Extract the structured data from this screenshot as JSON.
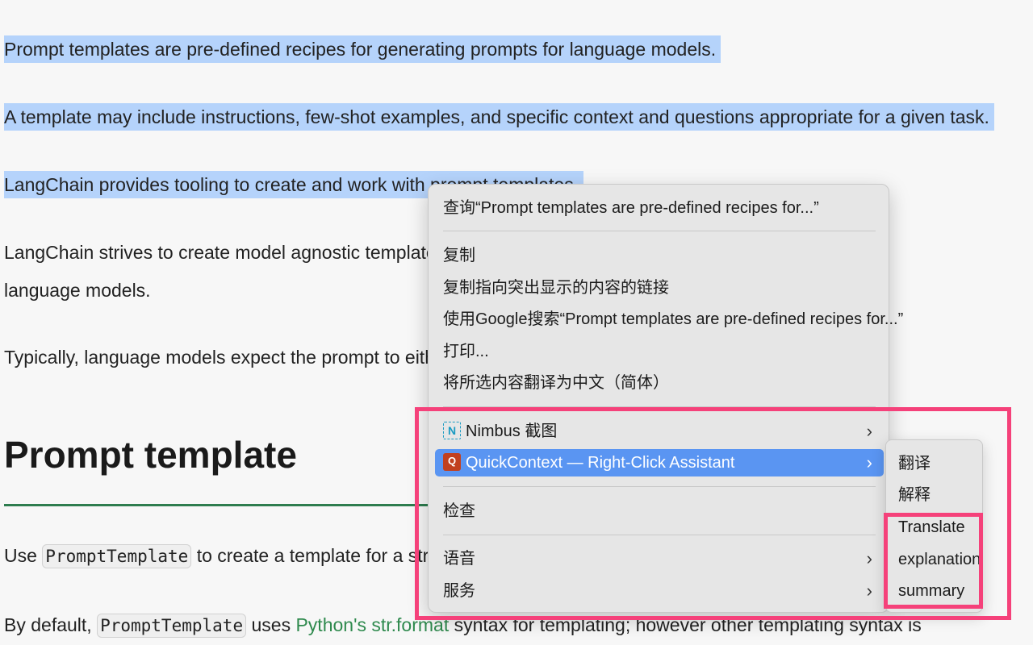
{
  "document": {
    "p1": "Prompt templates are pre-defined recipes for generating prompts for language models.",
    "p2": "A template may include instructions, few-shot examples, and specific context and questions appropriate for a given task.",
    "p3": "LangChain provides tooling to create and work with prompt templates.",
    "p4_line1": "LangChain strives to create model agnostic templates to m",
    "p4_line2": "language models.",
    "p5": "Typically, language models expect the prompt to either be",
    "heading": "Prompt template",
    "p6_before": "Use ",
    "p6_code": "PromptTemplate",
    "p6_after": " to create a template for a string pro",
    "p7_before": "By default, ",
    "p7_code": "PromptTemplate",
    "p7_mid": " uses ",
    "p7_link": "Python's str.format",
    "p7_after": " syntax for templating; however other templating syntax is"
  },
  "context_menu": {
    "lookup": "查询“Prompt templates are pre-defined recipes for...”",
    "copy": "复制",
    "copy_link_highlight": "复制指向突出显示的内容的链接",
    "search_google": "使用Google搜索“Prompt templates are pre-defined recipes for...”",
    "print": "打印...",
    "translate_selection": "将所选内容翻译为中文（简体）",
    "nimbus": "Nimbus 截图",
    "quickcontext": "QuickContext — Right-Click Assistant",
    "inspect": "检查",
    "speech": "语音",
    "services": "服务",
    "chevron": "›",
    "nimbus_icon_glyph": "N",
    "qc_icon_glyph": "Q"
  },
  "submenu": {
    "items": [
      "翻译",
      "解释",
      "Translate",
      "explanation",
      "summary"
    ]
  },
  "colors": {
    "selection_highlight": "#b5d3fb",
    "menu_active": "#5a95f2",
    "annotation": "#f5417a",
    "link": "#2f8a4e"
  }
}
